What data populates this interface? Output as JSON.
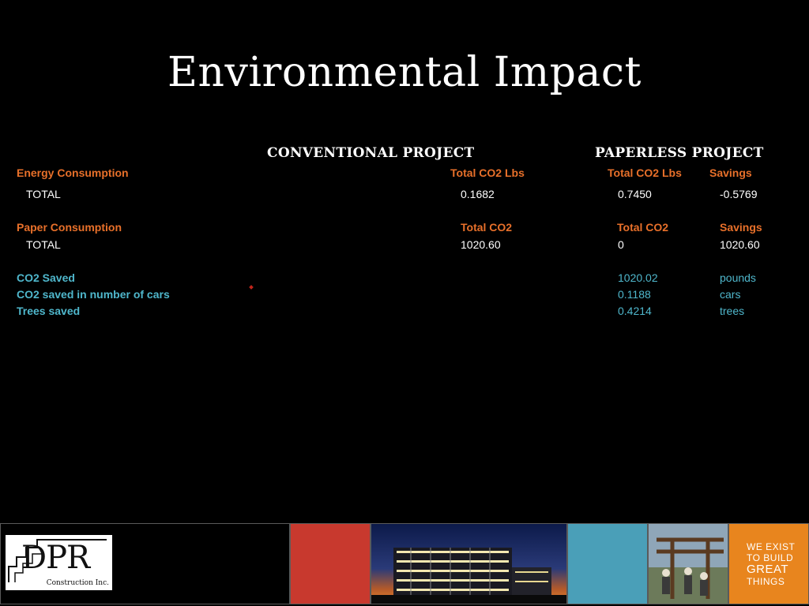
{
  "title": "Environmental Impact",
  "headers": {
    "conventional": "CONVENTIONAL PROJECT",
    "paperless": "PAPERLESS PROJECT"
  },
  "energy": {
    "label": "Energy Consumption",
    "col1": "Total CO2 Lbs",
    "col2": "Total CO2 Lbs",
    "col3": "Savings",
    "row_label": "TOTAL",
    "conventional": "0.1682",
    "paperless": "0.7450",
    "savings": "-0.5769"
  },
  "paper": {
    "label": "Paper Consumption",
    "col1": "Total CO2",
    "col2": "Total CO2",
    "col3": "Savings",
    "row_label": "TOTAL",
    "conventional": "1020.60",
    "paperless": "0",
    "savings": "1020.60"
  },
  "summary": [
    {
      "label": "CO2 Saved",
      "value": "1020.02",
      "unit": "pounds"
    },
    {
      "label": "CO2 saved in number of cars",
      "value": "0.1188",
      "unit": "cars"
    },
    {
      "label": "Trees saved",
      "value": "0.4214",
      "unit": "trees"
    }
  ],
  "footer": {
    "logo_letters": "DPR",
    "logo_sub": "Construction Inc.",
    "tagline_1": "WE EXIST",
    "tagline_2": "TO BUILD",
    "tagline_3": "GREAT",
    "tagline_4": "THINGS",
    "colors": {
      "red": "#c8392e",
      "teal": "#4a9fb8",
      "orange": "#e8851e"
    }
  }
}
